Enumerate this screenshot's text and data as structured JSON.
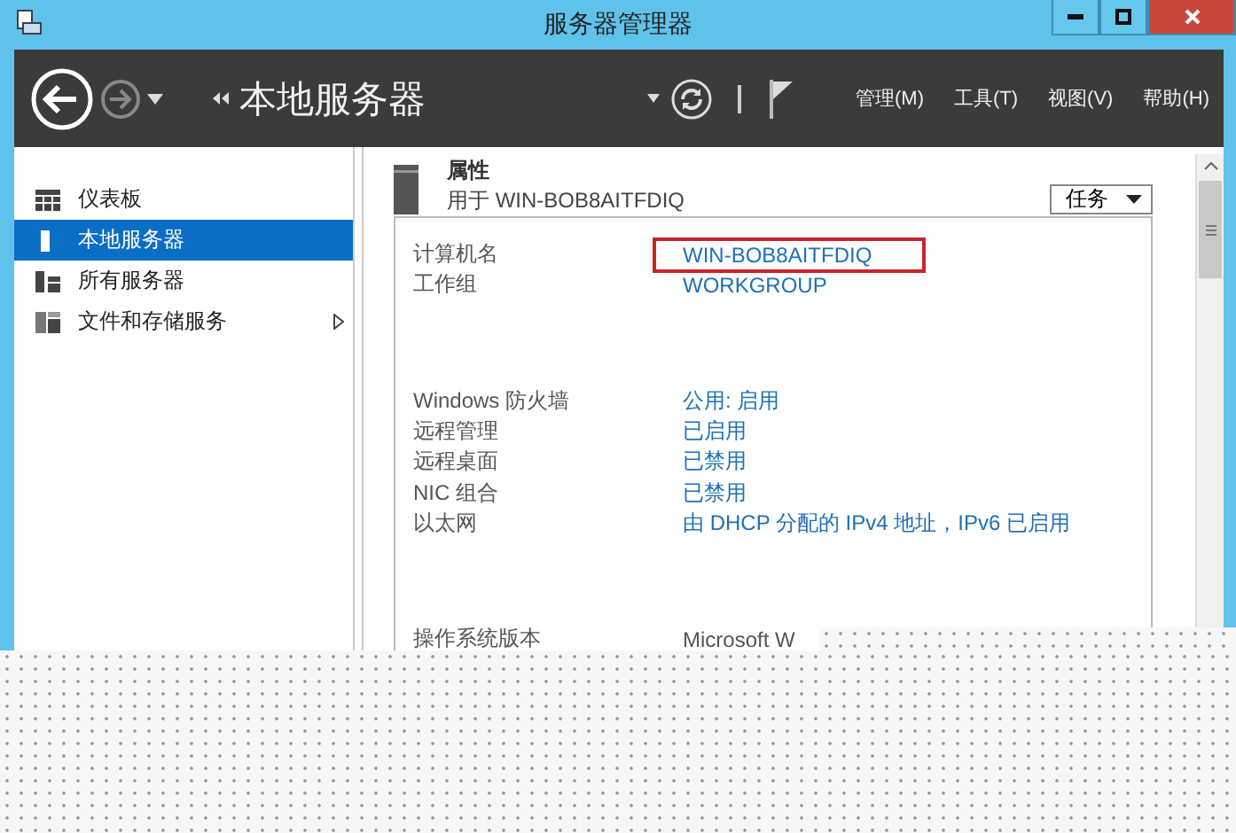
{
  "window": {
    "title": "服务器管理器"
  },
  "toolbar": {
    "breadcrumb": "本地服务器",
    "menus": [
      "管理(M)",
      "工具(T)",
      "视图(V)",
      "帮助(H)"
    ]
  },
  "sidebar": {
    "items": [
      {
        "label": "仪表板",
        "kind": "dashboard",
        "selected": false,
        "expandable": false
      },
      {
        "label": "本地服务器",
        "kind": "server",
        "selected": true,
        "expandable": false
      },
      {
        "label": "所有服务器",
        "kind": "servers",
        "selected": false,
        "expandable": false
      },
      {
        "label": "文件和存储服务",
        "kind": "storage",
        "selected": false,
        "expandable": true
      }
    ]
  },
  "properties": {
    "title": "属性",
    "subtitle": "用于 WIN-BOB8AITFDIQ",
    "tasks_button": "任务",
    "groups": [
      [
        {
          "label": "计算机名",
          "value": "WIN-BOB8AITFDIQ",
          "link": true,
          "highlighted": true
        },
        {
          "label": "工作组",
          "value": "WORKGROUP",
          "link": true,
          "highlighted": false
        }
      ],
      [
        {
          "label": "Windows 防火墙",
          "value": "公用: 启用",
          "link": true,
          "highlighted": false
        },
        {
          "label": "远程管理",
          "value": "已启用",
          "link": true,
          "highlighted": false
        },
        {
          "label": "远程桌面",
          "value": "已禁用",
          "link": true,
          "highlighted": false
        },
        {
          "label": "NIC 组合",
          "value": "已禁用",
          "link": true,
          "highlighted": false
        },
        {
          "label": "以太网",
          "value": "由 DHCP 分配的 IPv4 地址，IPv6 已启用",
          "link": true,
          "highlighted": false
        }
      ],
      [
        {
          "label": "操作系统版本",
          "value": "Microsoft W",
          "link": false,
          "highlighted": false
        }
      ]
    ]
  }
}
